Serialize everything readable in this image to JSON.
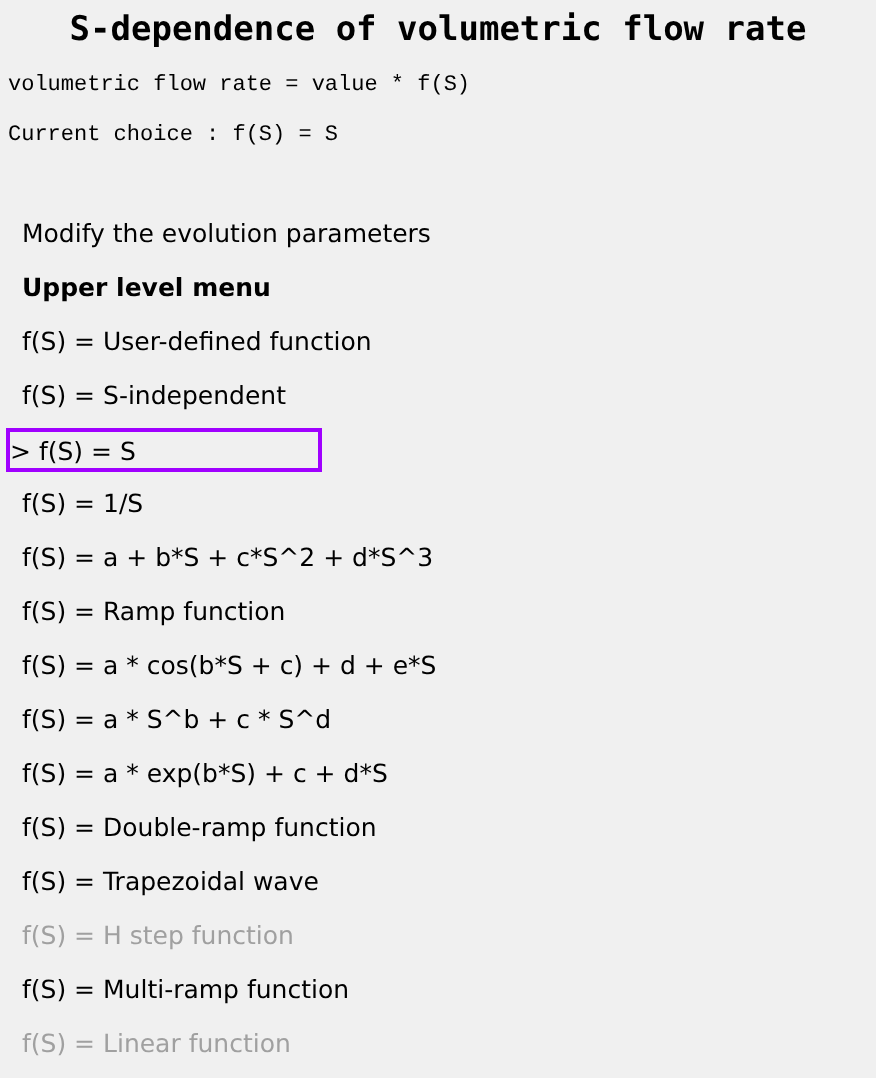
{
  "title": "S-dependence of volumetric flow rate",
  "info_lines": [
    "volumetric flow rate = value * f(S)",
    "Current choice : f(S) = S"
  ],
  "cursor": ">",
  "menu": [
    {
      "label": "Modify the evolution parameters",
      "kind": "option",
      "selected": false,
      "disabled": false
    },
    {
      "label": "Upper level menu",
      "kind": "header",
      "selected": false,
      "disabled": false
    },
    {
      "label": "f(S) = User-defined function",
      "kind": "option",
      "selected": false,
      "disabled": false
    },
    {
      "label": "f(S) = S-independent",
      "kind": "option",
      "selected": false,
      "disabled": false
    },
    {
      "label": "f(S) = S",
      "kind": "option",
      "selected": true,
      "disabled": false
    },
    {
      "label": "f(S) = 1/S",
      "kind": "option",
      "selected": false,
      "disabled": false
    },
    {
      "label": "f(S) = a + b*S + c*S^2 + d*S^3",
      "kind": "option",
      "selected": false,
      "disabled": false
    },
    {
      "label": "f(S) = Ramp function",
      "kind": "option",
      "selected": false,
      "disabled": false
    },
    {
      "label": "f(S) = a * cos(b*S + c) + d + e*S",
      "kind": "option",
      "selected": false,
      "disabled": false
    },
    {
      "label": "f(S) = a * S^b + c * S^d",
      "kind": "option",
      "selected": false,
      "disabled": false
    },
    {
      "label": "f(S) = a * exp(b*S) + c + d*S",
      "kind": "option",
      "selected": false,
      "disabled": false
    },
    {
      "label": "f(S) = Double-ramp function",
      "kind": "option",
      "selected": false,
      "disabled": false
    },
    {
      "label": "f(S) = Trapezoidal wave",
      "kind": "option",
      "selected": false,
      "disabled": false
    },
    {
      "label": "f(S) = H step function",
      "kind": "option",
      "selected": false,
      "disabled": true
    },
    {
      "label": "f(S) = Multi-ramp function",
      "kind": "option",
      "selected": false,
      "disabled": false
    },
    {
      "label": "f(S) = Linear function",
      "kind": "option",
      "selected": false,
      "disabled": true
    }
  ]
}
